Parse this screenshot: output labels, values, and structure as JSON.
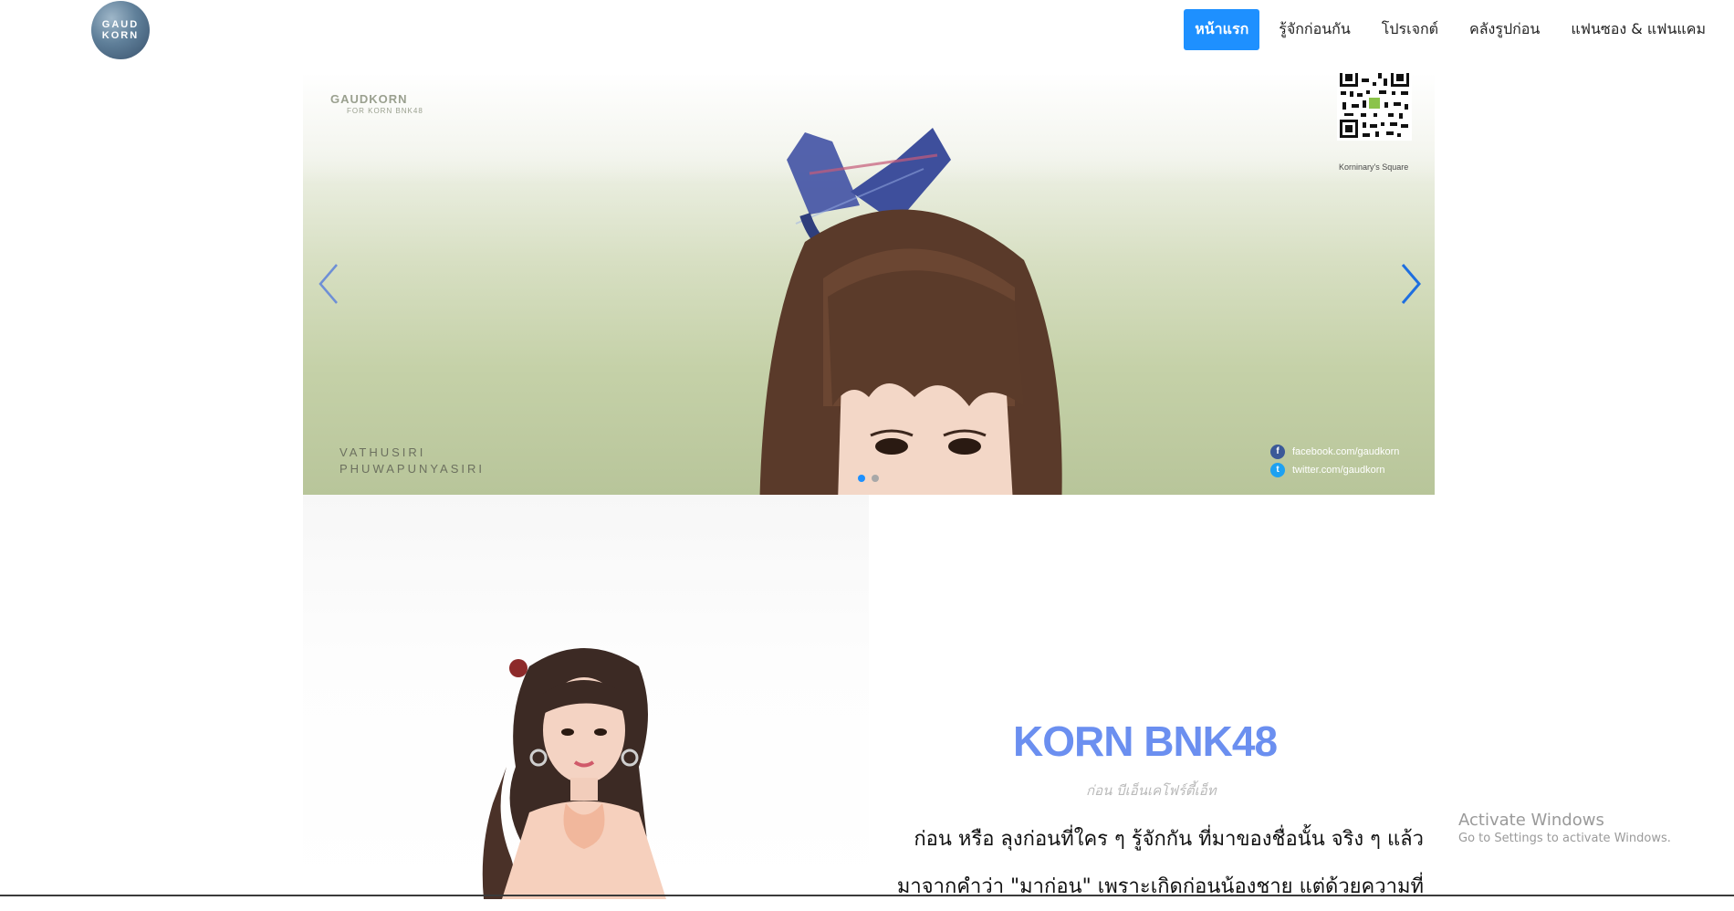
{
  "header": {
    "logo_text_top": "GAUD",
    "logo_text_bottom": "KORN",
    "nav": [
      {
        "label": "หน้าแรก",
        "active": true
      },
      {
        "label": "รู้จักก่อนกัน",
        "active": false
      },
      {
        "label": "โปรเจกต์",
        "active": false
      },
      {
        "label": "คลังรูปก่อน",
        "active": false
      },
      {
        "label": "แฟนซอง & แฟนแคม",
        "active": false
      }
    ]
  },
  "carousel": {
    "brand": "GAUDKORN",
    "brand_sub": "FOR KORN BNK48",
    "qr_caption": "Korninary's Square",
    "name_line1": "VATHUSIRI",
    "name_line2": "PHUWAPUNYASIRI",
    "facebook": "facebook.com/gaudkorn",
    "twitter": "twitter.com/gaudkorn",
    "slide_count": 2,
    "active_slide": 1
  },
  "profile": {
    "title": "KORN BNK48",
    "subtitle": "ก่อน บีเอ็นเคโฟร์ตี้เอ็ท",
    "body_line1": "ก่อน หรือ ลุงก่อนที่ใคร ๆ รู้จักกัน ที่มาของชื่อนั้น จริง ๆ แล้ว",
    "body_line2": "มาจากคำว่า \"มาก่อน\" เพราะเกิดก่อนน้องชาย แต่ด้วยความที่"
  },
  "watermark": {
    "title": "Activate Windows",
    "desc": "Go to Settings to activate Windows."
  },
  "colors": {
    "accent": "#1e90ff",
    "title_blue": "#6b8ff0"
  }
}
